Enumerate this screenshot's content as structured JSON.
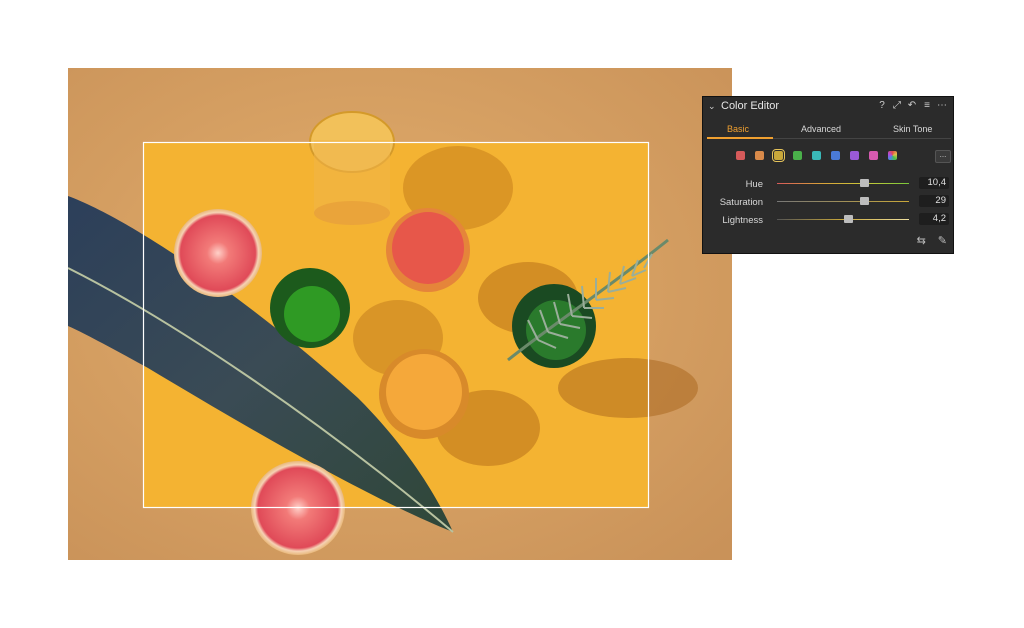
{
  "panel": {
    "title": "Color Editor",
    "header_icons": [
      "help-icon",
      "expand-icon",
      "reset-icon",
      "menu-icon",
      "more-icon"
    ],
    "header_glyphs": [
      "?",
      "⤢",
      "↶",
      "≡",
      "⋯"
    ],
    "tabs": [
      {
        "label": "Basic",
        "active": true
      },
      {
        "label": "Advanced",
        "active": false
      },
      {
        "label": "Skin Tone",
        "active": false
      }
    ],
    "swatches": [
      {
        "name": "red",
        "color": "#d65a5a",
        "selected": false
      },
      {
        "name": "orange",
        "color": "#d98a4a",
        "selected": false
      },
      {
        "name": "yellow",
        "color": "#c9a83a",
        "selected": true
      },
      {
        "name": "green",
        "color": "#4ab04a",
        "selected": false
      },
      {
        "name": "cyan",
        "color": "#3ab8b8",
        "selected": false
      },
      {
        "name": "blue",
        "color": "#4a7ad6",
        "selected": false
      },
      {
        "name": "purple",
        "color": "#9a5ad6",
        "selected": false
      },
      {
        "name": "magenta",
        "color": "#d65ab0",
        "selected": false
      },
      {
        "name": "all",
        "color": "multicolor",
        "selected": false
      }
    ],
    "more_label": "...",
    "sliders": [
      {
        "label": "Hue",
        "value": "10,4",
        "position": 0.66
      },
      {
        "label": "Saturation",
        "value": "29",
        "position": 0.66
      },
      {
        "label": "Lightness",
        "value": "4,2",
        "position": 0.54
      }
    ],
    "footer_icons": [
      "swap-icon",
      "picker-icon"
    ],
    "footer_glyphs": [
      "⇆",
      "✎"
    ]
  }
}
